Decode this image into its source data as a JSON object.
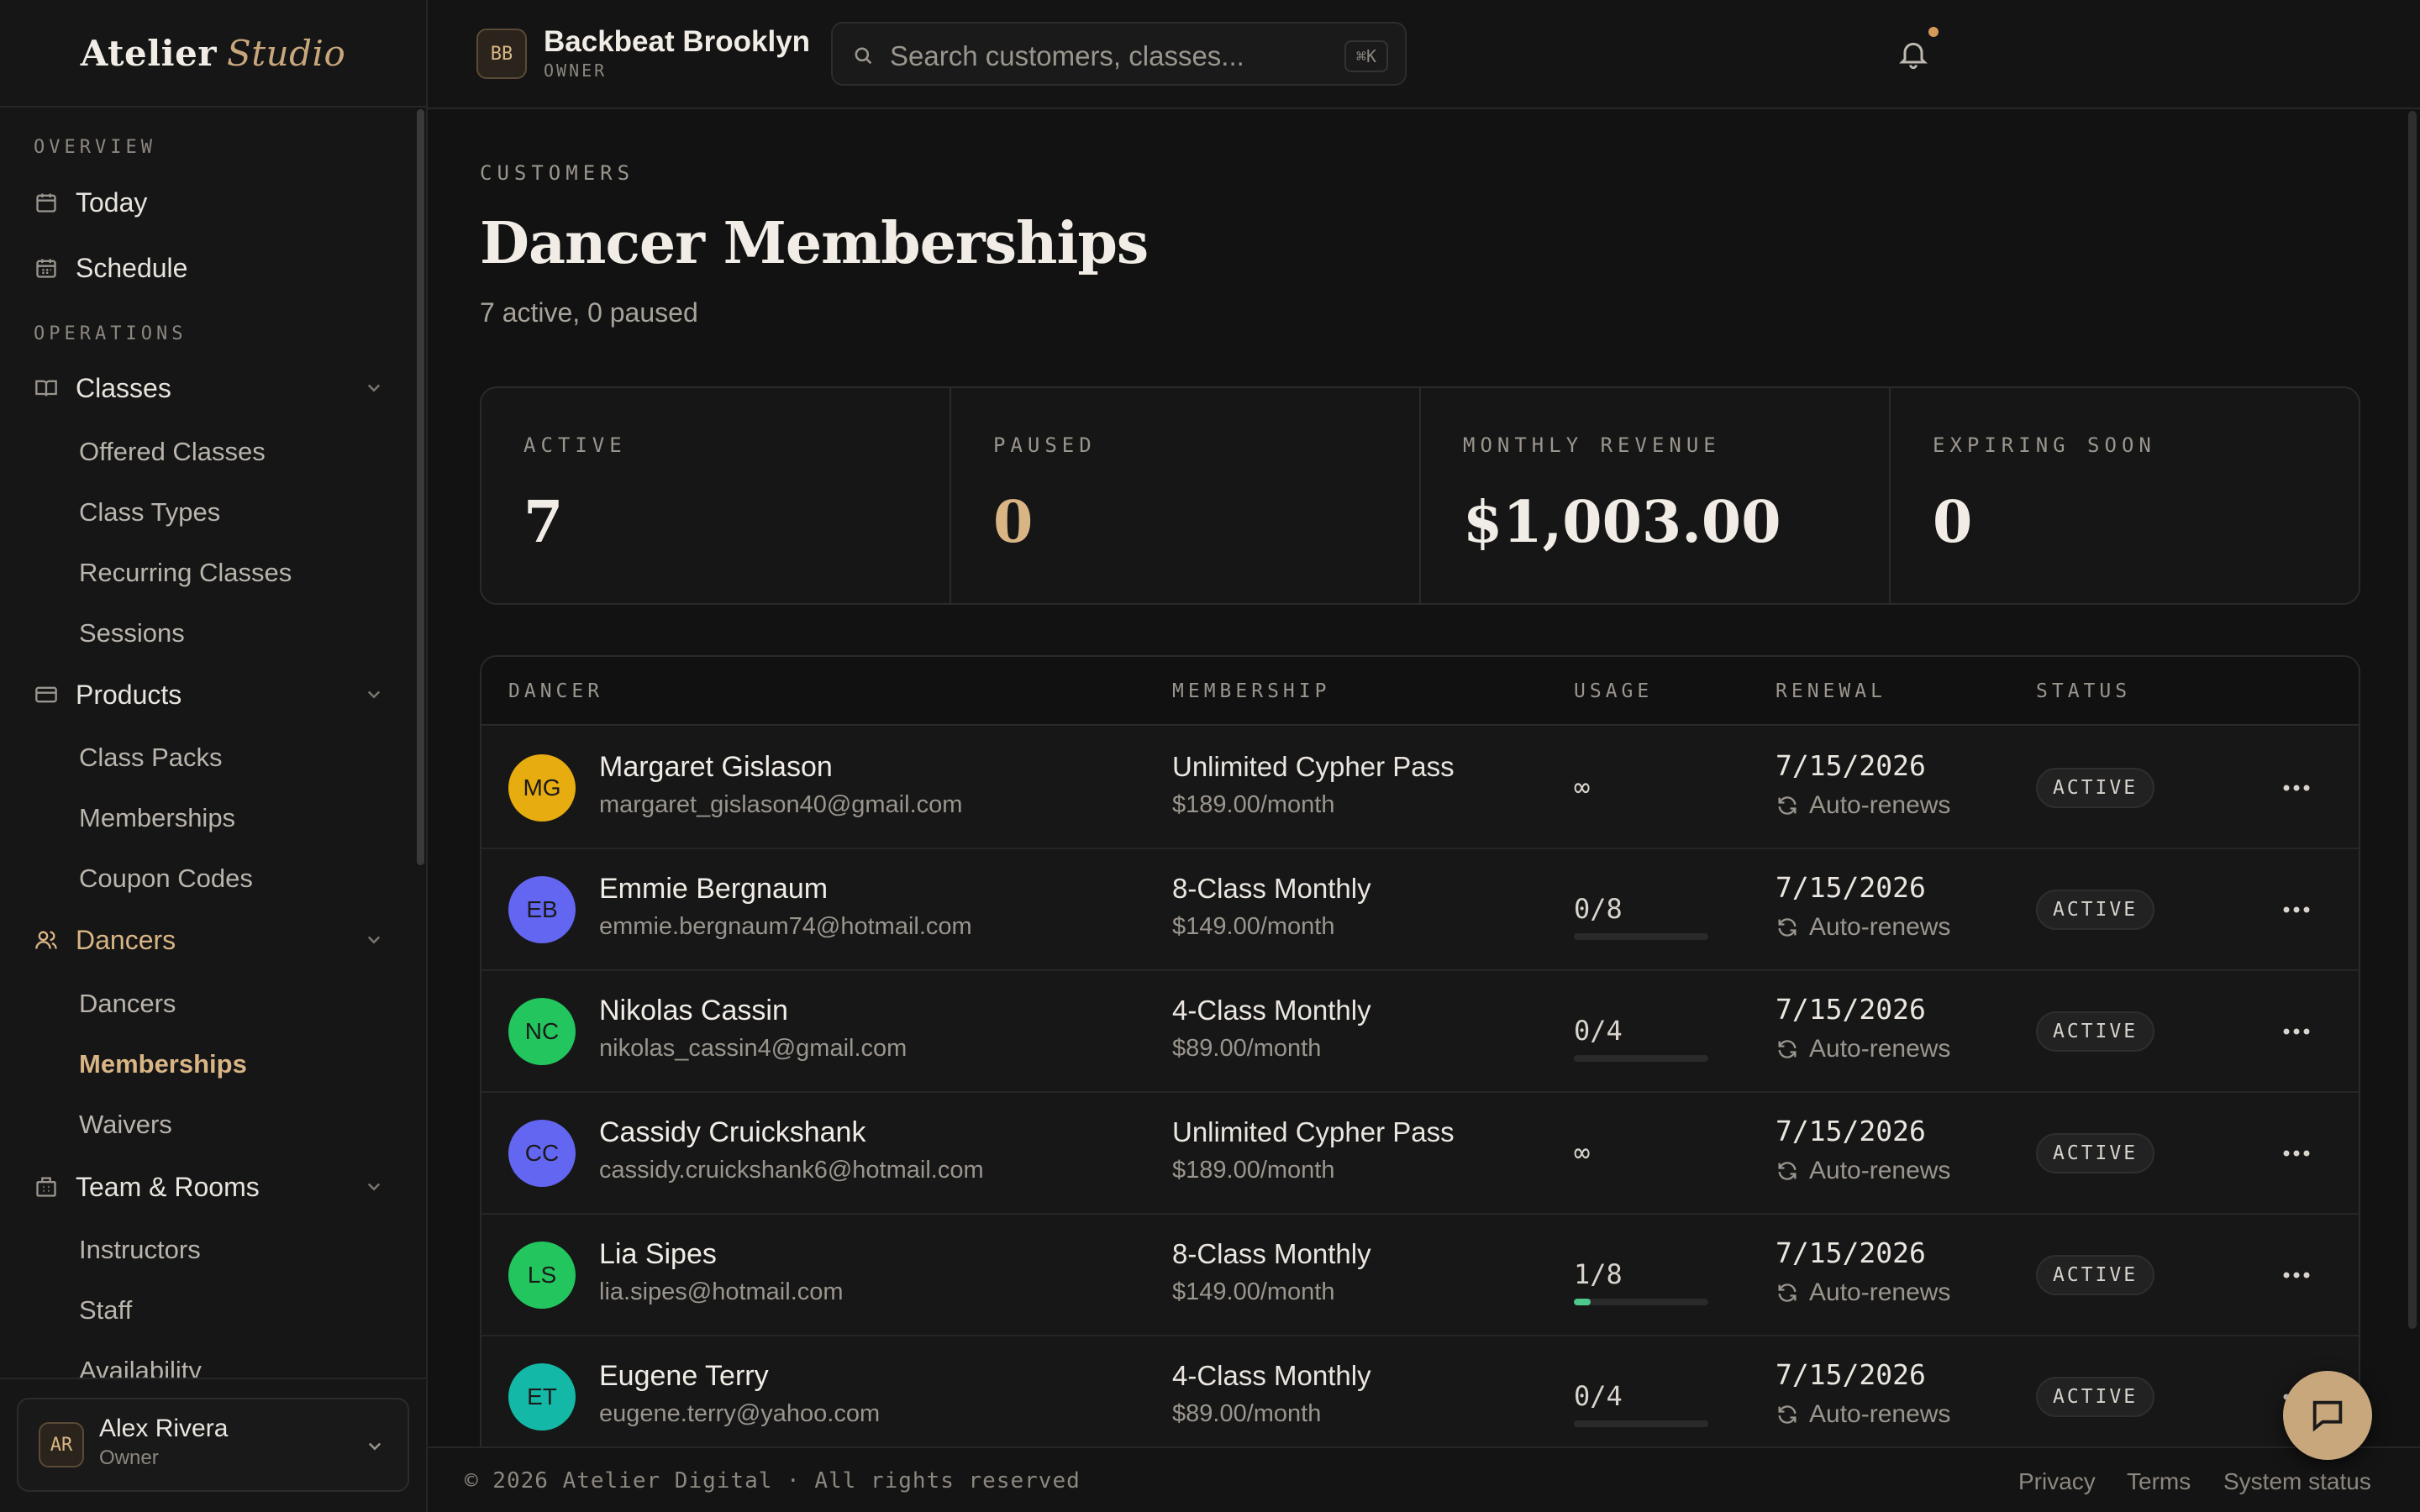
{
  "brand": {
    "name": "Atelier",
    "accent": "Studio"
  },
  "sidebar": {
    "sections": [
      {
        "label": "OVERVIEW"
      },
      {
        "label": "OPERATIONS"
      }
    ],
    "top_items": [
      {
        "label": "Today",
        "icon": "calendar-icon"
      },
      {
        "label": "Schedule",
        "icon": "calendar-grid-icon"
      },
      {
        "label": "Classes",
        "icon": "book-icon"
      },
      {
        "label": "Products",
        "icon": "card-icon"
      },
      {
        "label": "Dancers",
        "icon": "users-icon"
      },
      {
        "label": "Team & Rooms",
        "icon": "building-icon"
      }
    ],
    "sub_items": [
      {
        "label": "Offered Classes"
      },
      {
        "label": "Class Types"
      },
      {
        "label": "Recurring Classes"
      },
      {
        "label": "Sessions"
      },
      {
        "label": "Class Packs"
      },
      {
        "label": "Memberships"
      },
      {
        "label": "Coupon Codes"
      },
      {
        "label": "Dancers"
      },
      {
        "label": "Memberships"
      },
      {
        "label": "Waivers"
      },
      {
        "label": "Instructors"
      },
      {
        "label": "Staff"
      },
      {
        "label": "Availability"
      }
    ],
    "user": {
      "initials": "AR",
      "name": "Alex Rivera",
      "role": "Owner"
    }
  },
  "header": {
    "org_initials": "BB",
    "org_name": "Backbeat Brooklyn",
    "org_role": "OWNER",
    "search_placeholder": "Search customers, classes...",
    "search_shortcut": "⌘K"
  },
  "page": {
    "eyebrow": "CUSTOMERS",
    "title": "Dancer Memberships",
    "subtitle": "7 active, 0 paused"
  },
  "stats": [
    {
      "label": "ACTIVE",
      "value": "7"
    },
    {
      "label": "PAUSED",
      "value": "0"
    },
    {
      "label": "MONTHLY REVENUE",
      "value": "$1,003.00"
    },
    {
      "label": "EXPIRING SOON",
      "value": "0"
    }
  ],
  "table": {
    "columns": [
      "DANCER",
      "MEMBERSHIP",
      "USAGE",
      "RENEWAL",
      "STATUS"
    ],
    "rows": [
      {
        "initials": "MG",
        "avatar_color": "#e6ac10",
        "name": "Margaret Gislason",
        "email": "margaret_gislason40@gmail.com",
        "plan": "Unlimited Cypher Pass",
        "price": "$189.00/month",
        "usage": "∞",
        "usage_fraction": null,
        "renewal": "7/15/2026",
        "renew_note": "Auto-renews",
        "status": "ACTIVE"
      },
      {
        "initials": "EB",
        "avatar_color": "#6366f1",
        "name": "Emmie Bergnaum",
        "email": "emmie.bergnaum74@hotmail.com",
        "plan": "8-Class Monthly",
        "price": "$149.00/month",
        "usage": "0/8",
        "usage_fraction": 0,
        "renewal": "7/15/2026",
        "renew_note": "Auto-renews",
        "status": "ACTIVE"
      },
      {
        "initials": "NC",
        "avatar_color": "#22c55e",
        "name": "Nikolas Cassin",
        "email": "nikolas_cassin4@gmail.com",
        "plan": "4-Class Monthly",
        "price": "$89.00/month",
        "usage": "0/4",
        "usage_fraction": 0,
        "renewal": "7/15/2026",
        "renew_note": "Auto-renews",
        "status": "ACTIVE"
      },
      {
        "initials": "CC",
        "avatar_color": "#6366f1",
        "name": "Cassidy Cruickshank",
        "email": "cassidy.cruickshank6@hotmail.com",
        "plan": "Unlimited Cypher Pass",
        "price": "$189.00/month",
        "usage": "∞",
        "usage_fraction": null,
        "renewal": "7/15/2026",
        "renew_note": "Auto-renews",
        "status": "ACTIVE"
      },
      {
        "initials": "LS",
        "avatar_color": "#22c55e",
        "name": "Lia Sipes",
        "email": "lia.sipes@hotmail.com",
        "plan": "8-Class Monthly",
        "price": "$149.00/month",
        "usage": "1/8",
        "usage_fraction": 0.125,
        "renewal": "7/15/2026",
        "renew_note": "Auto-renews",
        "status": "ACTIVE"
      },
      {
        "initials": "ET",
        "avatar_color": "#14b8a6",
        "name": "Eugene Terry",
        "email": "eugene.terry@yahoo.com",
        "plan": "4-Class Monthly",
        "price": "$89.00/month",
        "usage": "0/4",
        "usage_fraction": 0,
        "renewal": "7/15/2026",
        "renew_note": "Auto-renews",
        "status": "ACTIVE"
      }
    ]
  },
  "footer": {
    "copyright": "© 2026 Atelier Digital · All rights reserved",
    "links": [
      "Privacy",
      "Terms",
      "System status"
    ]
  },
  "colors": {
    "accent": "#d9b585",
    "fab": "#c9a77c",
    "background": "#121212"
  }
}
